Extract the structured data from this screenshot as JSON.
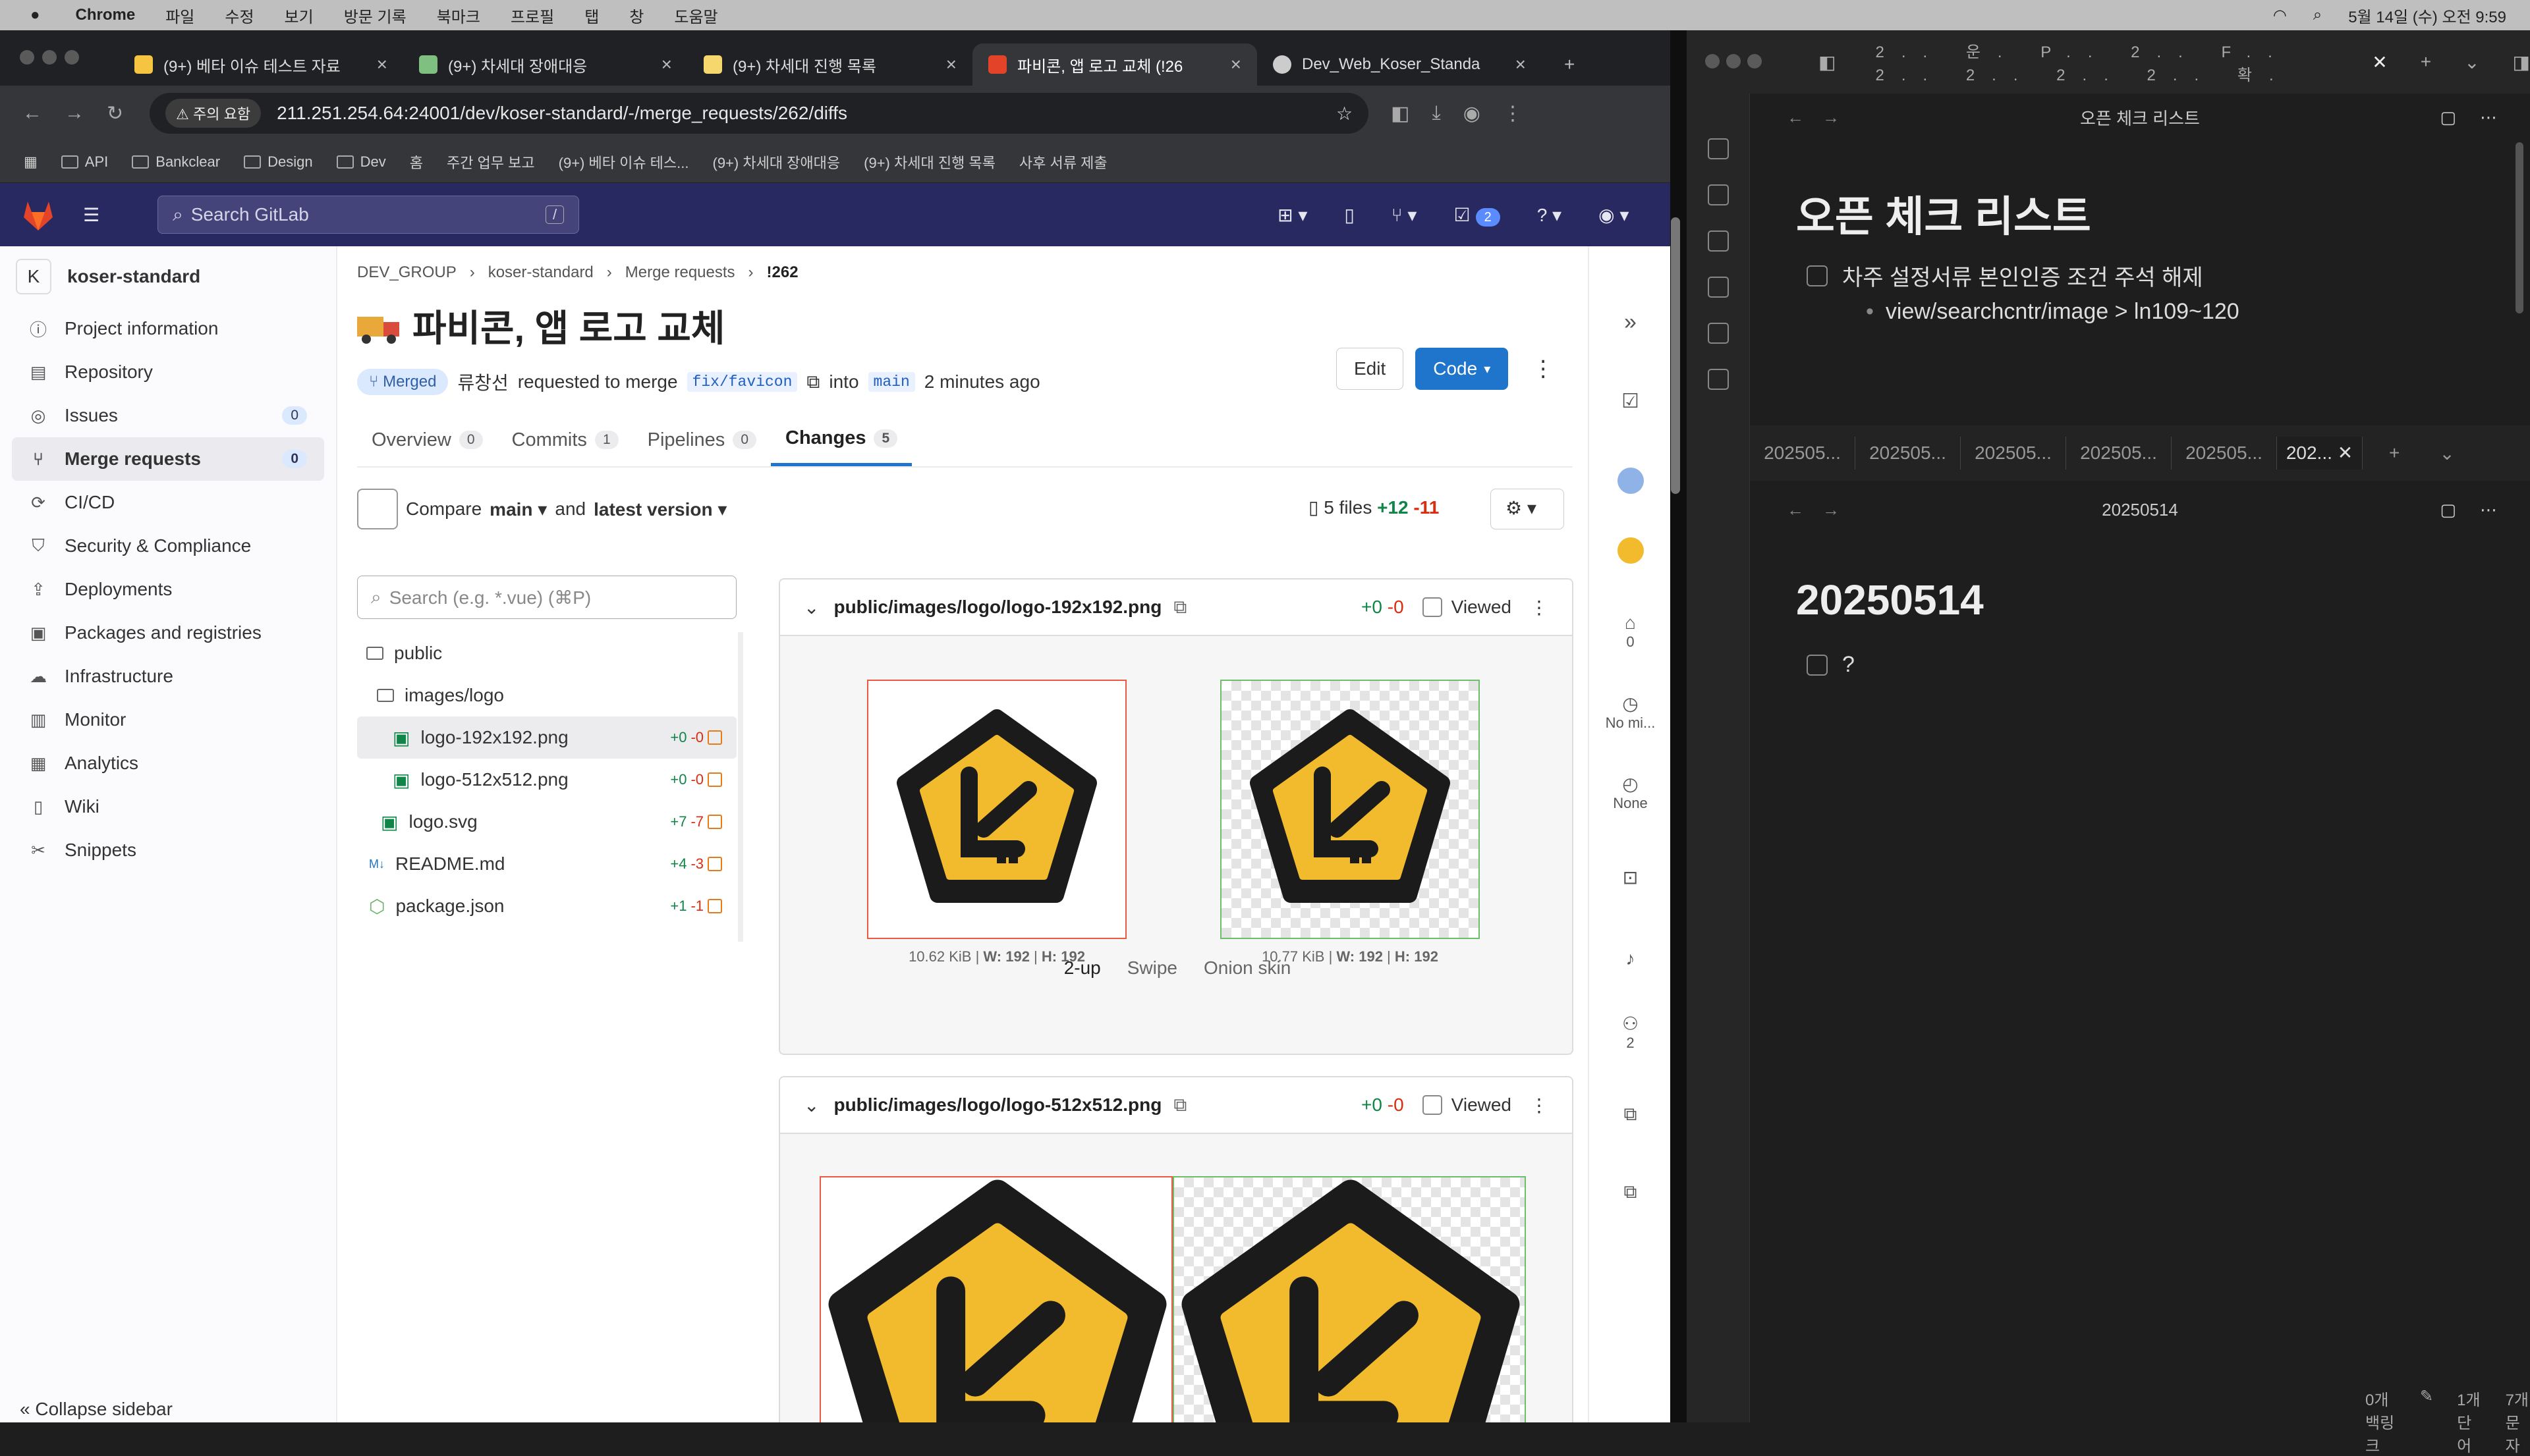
{
  "menubar": {
    "app": "Chrome",
    "items": [
      "파일",
      "수정",
      "보기",
      "방문 기록",
      "북마크",
      "프로필",
      "탭",
      "창",
      "도움말"
    ],
    "clock": "5월 14일 (수) 오전 9:59"
  },
  "tabs": [
    {
      "title": "(9+) 베타 이슈 테스트 자료",
      "color": "#f5c542"
    },
    {
      "title": "(9+) 차세대 장애대응",
      "color": "#7fbf7f"
    },
    {
      "title": "(9+) 차세대 진행 목록",
      "color": "#f5d76e"
    },
    {
      "title": "파비콘, 앱 로고 교체 (!26",
      "color": "#e24329"
    },
    {
      "title": "Dev_Web_Koser_Standa",
      "color": "#cccccc"
    }
  ],
  "address": {
    "warning": "주의 요함",
    "url": "211.251.254.64:24001/dev/koser-standard/-/merge_requests/262/diffs"
  },
  "bookmarks": [
    "API",
    "Bankclear",
    "Design",
    "Dev",
    "홈",
    "주간 업무 보고",
    "(9+) 베타 이슈 테스...",
    "(9+) 차세대 장애대응",
    "(9+) 차세대 진행 목록",
    "사후 서류 제출"
  ],
  "gitlab": {
    "search_placeholder": "Search GitLab",
    "slash": "/",
    "todo_count": "2"
  },
  "sidebar": {
    "project_initial": "K",
    "project": "koser-standard",
    "items": [
      {
        "label": "Project information",
        "icon": "ⓘ"
      },
      {
        "label": "Repository",
        "icon": "▤"
      },
      {
        "label": "Issues",
        "icon": "◎",
        "count": "0"
      },
      {
        "label": "Merge requests",
        "icon": "⑂",
        "count": "0"
      },
      {
        "label": "CI/CD",
        "icon": "⟳"
      },
      {
        "label": "Security & Compliance",
        "icon": "⛉"
      },
      {
        "label": "Deployments",
        "icon": "⇪"
      },
      {
        "label": "Packages and registries",
        "icon": "▣"
      },
      {
        "label": "Infrastructure",
        "icon": "☁"
      },
      {
        "label": "Monitor",
        "icon": "▥"
      },
      {
        "label": "Analytics",
        "icon": "▦"
      },
      {
        "label": "Wiki",
        "icon": "▯"
      },
      {
        "label": "Snippets",
        "icon": "✂"
      }
    ],
    "collapse": "Collapse sidebar"
  },
  "mr": {
    "crumbs": [
      "DEV_GROUP",
      "koser-standard",
      "Merge requests",
      "!262"
    ],
    "title": "파비콘, 앱 로고 교체",
    "edit": "Edit",
    "code": "Code",
    "status": "Merged",
    "author": "류창선",
    "requested": "requested to merge",
    "source": "fix/favicon",
    "into": "into",
    "target": "main",
    "time": "2 minutes ago",
    "tabs": [
      {
        "label": "Overview",
        "n": "0"
      },
      {
        "label": "Commits",
        "n": "1"
      },
      {
        "label": "Pipelines",
        "n": "0"
      },
      {
        "label": "Changes",
        "n": "5"
      }
    ],
    "compare": "Compare",
    "base": "main",
    "and": "and",
    "version": "latest version",
    "files_count": "5 files",
    "add": "+12",
    "del": "-11",
    "tree_search": "Search (e.g. *.vue) (⌘P)",
    "tree": [
      {
        "name": "public",
        "kind": "folder"
      },
      {
        "name": "images/logo",
        "kind": "folder"
      },
      {
        "name": "logo-192x192.png",
        "add": "+0",
        "del": "-0"
      },
      {
        "name": "logo-512x512.png",
        "add": "+0",
        "del": "-0"
      },
      {
        "name": "logo.svg",
        "add": "+7",
        "del": "-7"
      },
      {
        "name": "README.md",
        "add": "+4",
        "del": "-3"
      },
      {
        "name": "package.json",
        "add": "+1",
        "del": "-1"
      }
    ],
    "diffs": [
      {
        "path": "public/images/logo/logo-192x192.png",
        "add": "+0",
        "del": "-0",
        "viewed": "Viewed",
        "old": {
          "size": "10.62 KiB",
          "w": "W: 192",
          "h": "H: 192"
        },
        "new": {
          "size": "10.77 KiB",
          "w": "W: 192",
          "h": "H: 192"
        }
      },
      {
        "path": "public/images/logo/logo-512x512.png",
        "add": "+0",
        "del": "-0",
        "viewed": "Viewed"
      }
    ],
    "modes": [
      "2-up",
      "Swipe",
      "Onion skin"
    ]
  },
  "rail": {
    "labels_count": "0",
    "milestone": "No mi...",
    "time": "None",
    "participants": "2"
  },
  "obsidian": {
    "pane1_title": "오픈 체크 리스트",
    "pane1_h1": "오픈 체크 리스트",
    "task1": "차주 설정서류 본인인증 조건 주석 해제",
    "task1_sub": "view/searchcntr/image > ln109~120",
    "tabs": [
      "202505...",
      "202505...",
      "202505...",
      "202505...",
      "202505...",
      "202..."
    ],
    "pane2_title": "20250514",
    "pane2_h1": "20250514",
    "task2": "?",
    "status": [
      "0개 백링크",
      "1개 단어",
      "7개 문자"
    ]
  },
  "colors": {
    "gitlab_header": "#292961",
    "accent": "#1f75cb",
    "logo_yellow": "#f2bb2e"
  }
}
